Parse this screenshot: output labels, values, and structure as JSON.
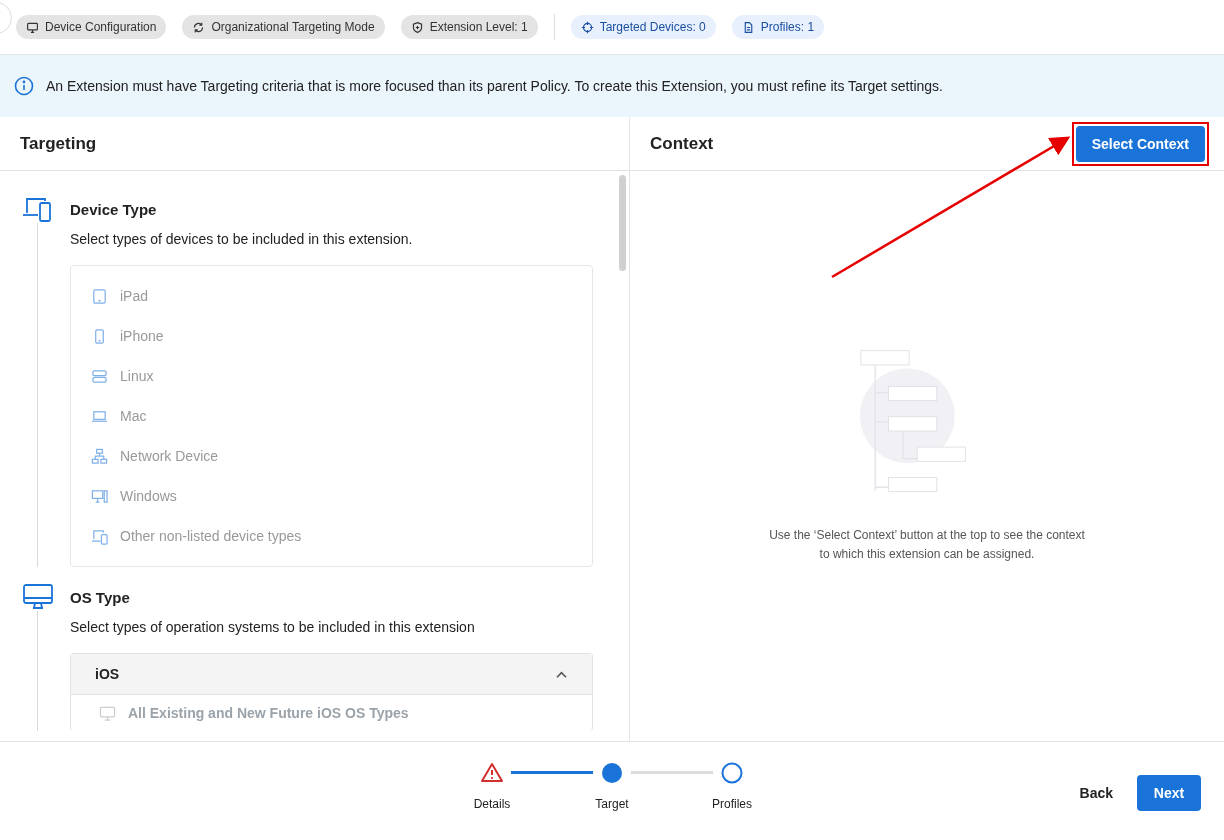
{
  "chips": [
    {
      "label": "Device Configuration",
      "kind": "monitor"
    },
    {
      "label": "Organizational Targeting Mode",
      "kind": "sync"
    },
    {
      "label": "Extension Level: 1",
      "kind": "shield"
    },
    {
      "label": "Targeted Devices: 0",
      "kind": "target"
    },
    {
      "label": "Profiles: 1",
      "kind": "document"
    }
  ],
  "banner": {
    "text": "An Extension must have Targeting criteria that is more focused than its parent Policy. To create this Extension, you must refine its Target settings."
  },
  "targeting": {
    "title": "Targeting",
    "device_type": {
      "title": "Device Type",
      "description": "Select types of devices to be included in this extension.",
      "items": [
        {
          "label": "iPad",
          "kind": "tablet",
          "disabled": true
        },
        {
          "label": "iPhone",
          "kind": "phone",
          "disabled": true
        },
        {
          "label": "Linux",
          "kind": "server",
          "disabled": true
        },
        {
          "label": "Mac",
          "kind": "laptop",
          "disabled": true
        },
        {
          "label": "Network Device",
          "kind": "network",
          "disabled": true
        },
        {
          "label": "Windows",
          "kind": "desktop",
          "disabled": true
        },
        {
          "label": "Other non-listed device types",
          "kind": "devices",
          "disabled": true
        }
      ]
    },
    "os_type": {
      "title": "OS Type",
      "description": "Select types of operation systems to be included in this extension",
      "groups": [
        {
          "label": "iOS",
          "expanded": true,
          "options": [
            {
              "label": "All Existing and New Future iOS OS Types",
              "disabled": true
            }
          ]
        }
      ]
    }
  },
  "context": {
    "title": "Context",
    "button": "Select Context",
    "empty_text": "Use the ‘Select Context’ button at the top to see the context to which this extension can be assigned."
  },
  "steps": [
    {
      "label": "Details",
      "kind": "error"
    },
    {
      "label": "Target",
      "kind": "current"
    },
    {
      "label": "Profiles",
      "kind": "upcoming"
    }
  ],
  "footer": {
    "back": "Back",
    "next": "Next"
  }
}
